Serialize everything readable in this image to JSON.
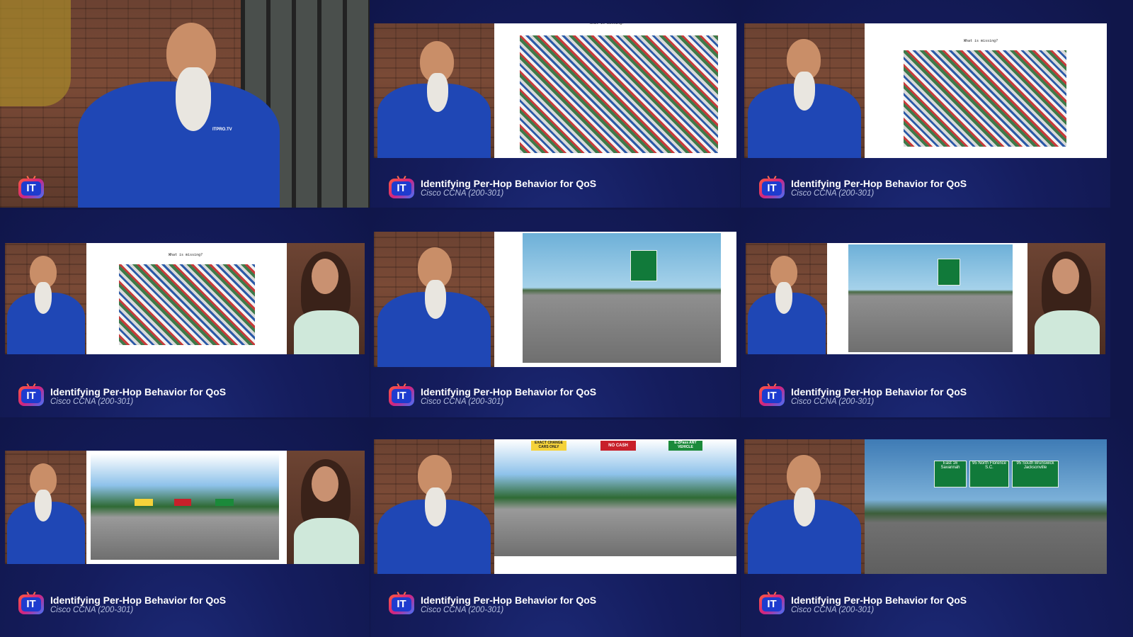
{
  "video": {
    "title": "Identifying Per-Hop Behavior for QoS",
    "course": "Cisco CCNA (200-301)",
    "logo_text": "IT"
  },
  "slide": {
    "question": "What is missing?"
  },
  "signs": {
    "toll_left": "EXACT CHANGE CARS ONLY",
    "toll_center": "NO CASH",
    "toll_right": "E-ZPass ANY VEHICLE",
    "overpass_1": "East 16 Savannah",
    "overpass_2": "95 North Florence S.C.",
    "overpass_3": "95 South Brunswick Jacksonville"
  },
  "colors": {
    "background": "#10164a",
    "title": "#ffffff",
    "subtitle": "#b4bedf",
    "shirt": "#1f47b5"
  }
}
